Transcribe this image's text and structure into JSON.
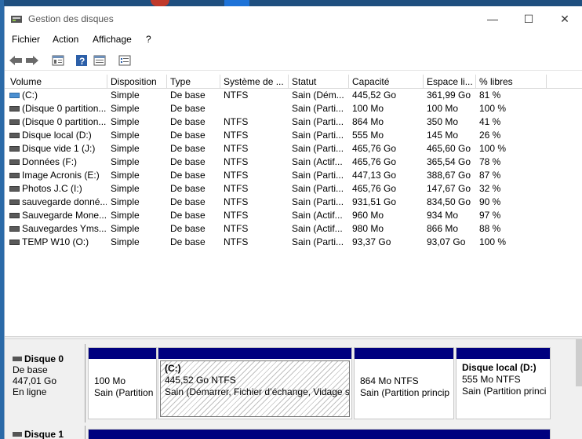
{
  "window": {
    "title": "Gestion des disques",
    "minimize": "—",
    "maximize": "☐",
    "close": "✕"
  },
  "menu": [
    "Fichier",
    "Action",
    "Affichage",
    "?"
  ],
  "toolbar": [
    "back-arrow-icon",
    "forward-arrow-icon",
    "properties-icon",
    "help-icon",
    "view-icon",
    "settings-icon"
  ],
  "columns": [
    "Volume",
    "Disposition",
    "Type",
    "Système de ...",
    "Statut",
    "Capacité",
    "Espace li...",
    "% libres"
  ],
  "rows": [
    {
      "vol": "(C:)",
      "disp": "Simple",
      "type": "De base",
      "fs": "NTFS",
      "status": "Sain (Dém...",
      "cap": "445,52 Go",
      "free": "361,99 Go",
      "pct": "81 %"
    },
    {
      "vol": "(Disque 0 partition...",
      "disp": "Simple",
      "type": "De base",
      "fs": "",
      "status": "Sain (Parti...",
      "cap": "100 Mo",
      "free": "100 Mo",
      "pct": "100 %"
    },
    {
      "vol": "(Disque 0 partition...",
      "disp": "Simple",
      "type": "De base",
      "fs": "NTFS",
      "status": "Sain (Parti...",
      "cap": "864 Mo",
      "free": "350 Mo",
      "pct": "41 %"
    },
    {
      "vol": "Disque local (D:)",
      "disp": "Simple",
      "type": "De base",
      "fs": "NTFS",
      "status": "Sain (Parti...",
      "cap": "555 Mo",
      "free": "145 Mo",
      "pct": "26 %"
    },
    {
      "vol": "Disque vide 1 (J:)",
      "disp": "Simple",
      "type": "De base",
      "fs": "NTFS",
      "status": "Sain (Parti...",
      "cap": "465,76 Go",
      "free": "465,60 Go",
      "pct": "100 %"
    },
    {
      "vol": "Données (F:)",
      "disp": "Simple",
      "type": "De base",
      "fs": "NTFS",
      "status": "Sain (Actif...",
      "cap": "465,76 Go",
      "free": "365,54 Go",
      "pct": "78 %"
    },
    {
      "vol": "Image Acronis (E:)",
      "disp": "Simple",
      "type": "De base",
      "fs": "NTFS",
      "status": "Sain (Parti...",
      "cap": "447,13 Go",
      "free": "388,67 Go",
      "pct": "87 %"
    },
    {
      "vol": "Photos J.C (I:)",
      "disp": "Simple",
      "type": "De base",
      "fs": "NTFS",
      "status": "Sain (Parti...",
      "cap": "465,76 Go",
      "free": "147,67 Go",
      "pct": "32 %"
    },
    {
      "vol": "sauvegarde donné...",
      "disp": "Simple",
      "type": "De base",
      "fs": "NTFS",
      "status": "Sain (Parti...",
      "cap": "931,51 Go",
      "free": "834,50 Go",
      "pct": "90 %"
    },
    {
      "vol": "Sauvegarde Mone...",
      "disp": "Simple",
      "type": "De base",
      "fs": "NTFS",
      "status": "Sain (Actif...",
      "cap": "960 Mo",
      "free": "934 Mo",
      "pct": "97 %"
    },
    {
      "vol": "Sauvegardes Yms...",
      "disp": "Simple",
      "type": "De base",
      "fs": "NTFS",
      "status": "Sain (Actif...",
      "cap": "980 Mo",
      "free": "866 Mo",
      "pct": "88 %"
    },
    {
      "vol": "TEMP W10 (O:)",
      "disp": "Simple",
      "type": "De base",
      "fs": "NTFS",
      "status": "Sain (Parti...",
      "cap": "93,37 Go",
      "free": "93,07 Go",
      "pct": "100 %"
    }
  ],
  "disk0": {
    "name": "Disque 0",
    "kind": "De base",
    "size": "447,01 Go",
    "state": "En ligne",
    "partitions": [
      {
        "title": "",
        "size": "100 Mo",
        "status": "Sain (Partition"
      },
      {
        "title": "(C:)",
        "size": "445,52 Go NTFS",
        "status": "Sain (Démarrer, Fichier d’échange, Vidage su"
      },
      {
        "title": "",
        "size": "864 Mo NTFS",
        "status": "Sain (Partition princip"
      },
      {
        "title": "Disque local  (D:)",
        "size": "555 Mo NTFS",
        "status": "Sain (Partition princi"
      }
    ]
  },
  "disk1": {
    "name": "Disque 1"
  }
}
